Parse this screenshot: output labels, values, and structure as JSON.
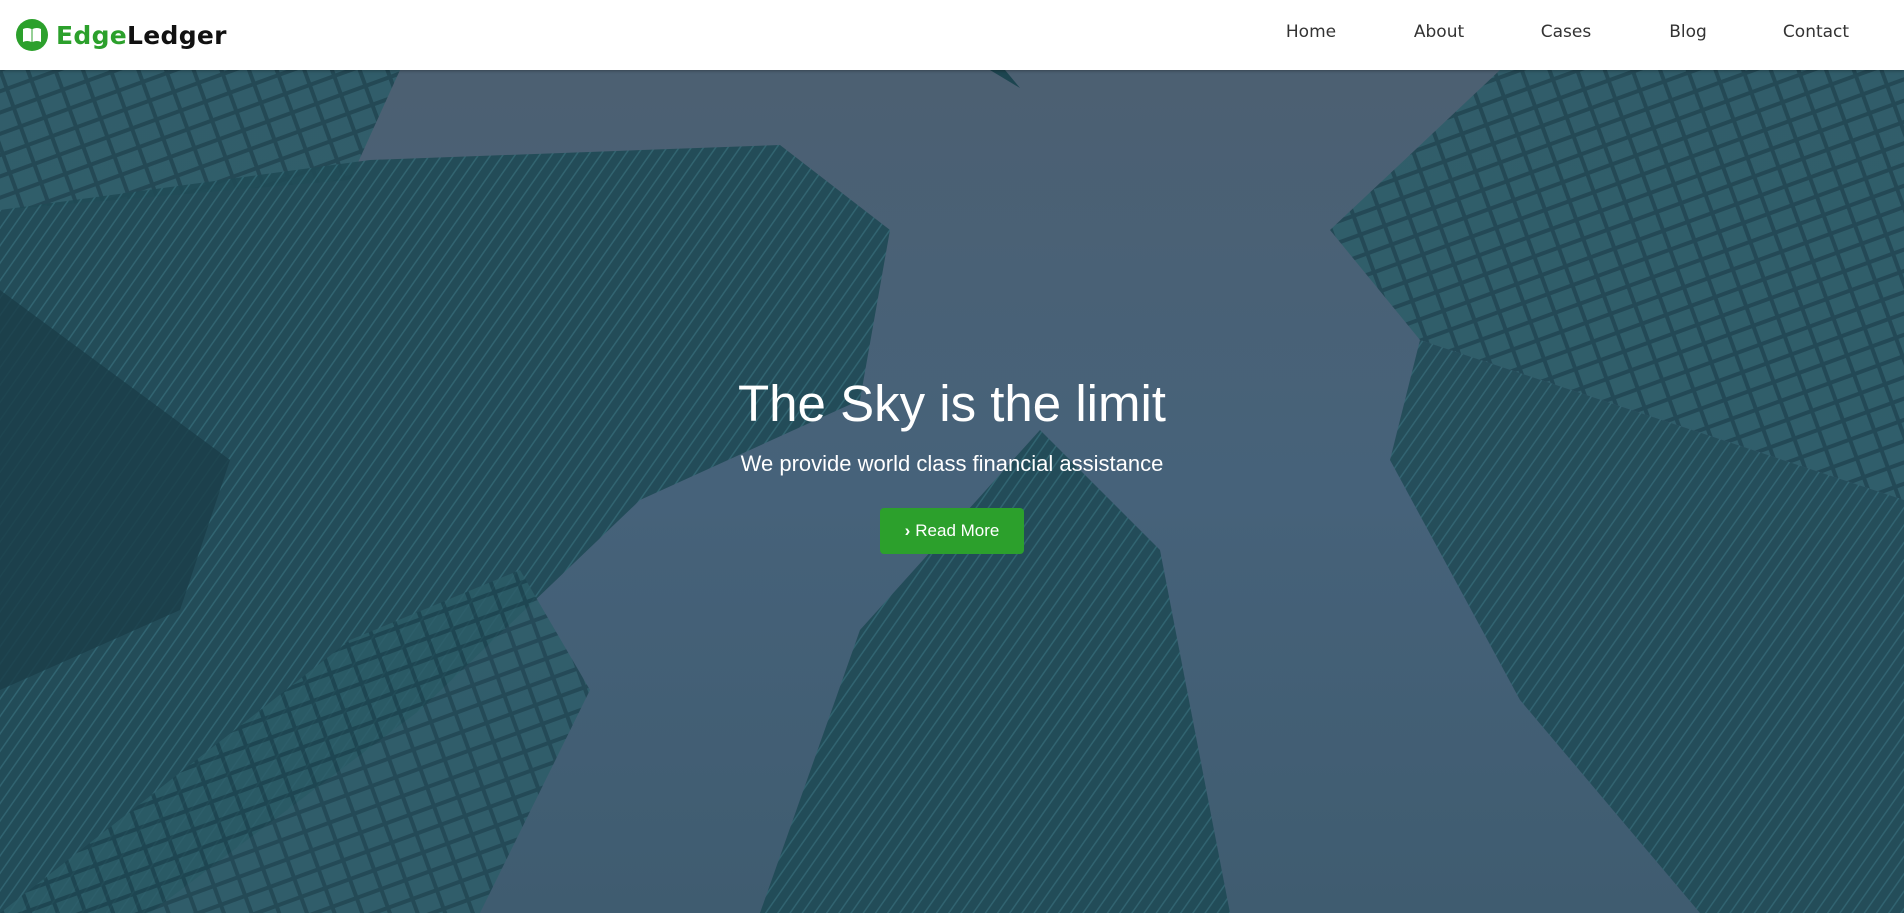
{
  "brand": {
    "part1": "Edge",
    "part2": "Ledger",
    "icon": "book-icon"
  },
  "nav": {
    "items": [
      {
        "label": "Home"
      },
      {
        "label": "About"
      },
      {
        "label": "Cases"
      },
      {
        "label": "Blog"
      },
      {
        "label": "Contact"
      }
    ]
  },
  "hero": {
    "title": "The Sky is the limit",
    "subtitle": "We provide world class financial assistance",
    "button_label": "Read More",
    "button_icon": "chevron-right-icon"
  },
  "colors": {
    "accent": "#2ca02c"
  }
}
